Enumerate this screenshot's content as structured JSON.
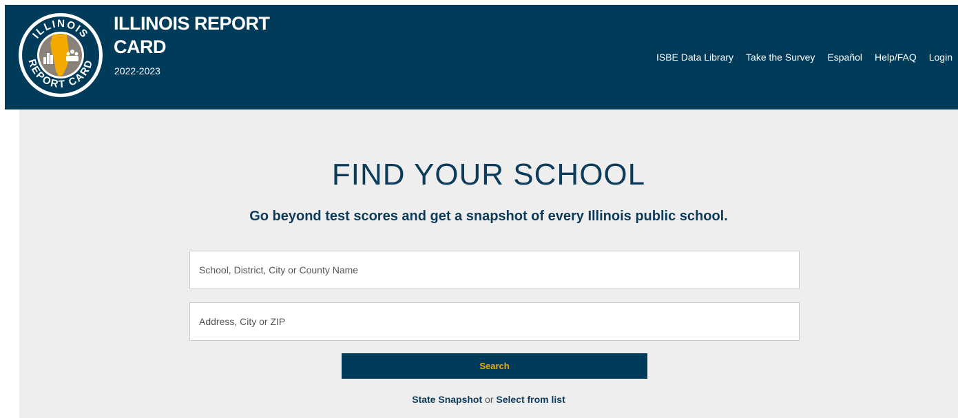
{
  "header": {
    "title": "ILLINOIS REPORT CARD",
    "year": "2022-2023",
    "logo_text_top": "ILLINOIS",
    "logo_text_bottom": "REPORT CARD",
    "nav": [
      {
        "label": "ISBE Data Library"
      },
      {
        "label": "Take the Survey"
      },
      {
        "label": "Español"
      },
      {
        "label": "Help/FAQ"
      },
      {
        "label": "Login"
      }
    ]
  },
  "main": {
    "title": "FIND YOUR SCHOOL",
    "subtitle": "Go beyond test scores and get a snapshot of every Illinois public school.",
    "school_input": {
      "value": "",
      "placeholder": "School, District, City or County Name"
    },
    "address_input": {
      "value": "",
      "placeholder": "Address, City or ZIP"
    },
    "search_label": "Search",
    "state_snapshot_label": "State Snapshot",
    "or_text": "or",
    "select_list_label": "Select from list"
  },
  "colors": {
    "header_bg": "#003c5a",
    "accent": "#f2a900",
    "main_bg": "#eeeeee",
    "heading_text": "#0d3b5a"
  },
  "icons": [
    "illinois-report-card-logo",
    "bar-chart-icon",
    "people-icon"
  ]
}
